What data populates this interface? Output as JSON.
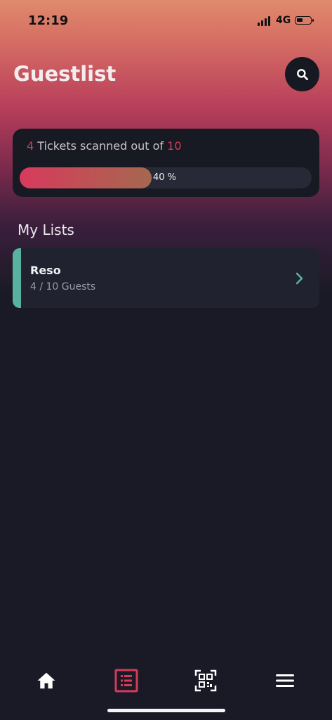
{
  "status_bar": {
    "time": "12:19",
    "network": "4G",
    "icons": [
      "signal-icon",
      "battery-icon"
    ]
  },
  "header": {
    "title": "Guestlist",
    "icon": "search-icon"
  },
  "summary": {
    "scanned": "4",
    "text": " Tickets scanned out of ",
    "total": "10",
    "progress_fraction": 0.4,
    "progress_label": "40 %"
  },
  "section": {
    "title": "My Lists"
  },
  "lists": [
    {
      "name": "Reso",
      "guests": "4 / 10 Guests",
      "icon": "chevron-right-icon"
    }
  ],
  "bottom_nav": {
    "items": [
      "home-icon",
      "list-icon",
      "qr-code-icon",
      "menu-icon"
    ],
    "active_index": 1
  },
  "colors": {
    "accent": "#d63a5a",
    "teal": "#57b3a0",
    "background": "#191a25",
    "card": "#20232f"
  }
}
